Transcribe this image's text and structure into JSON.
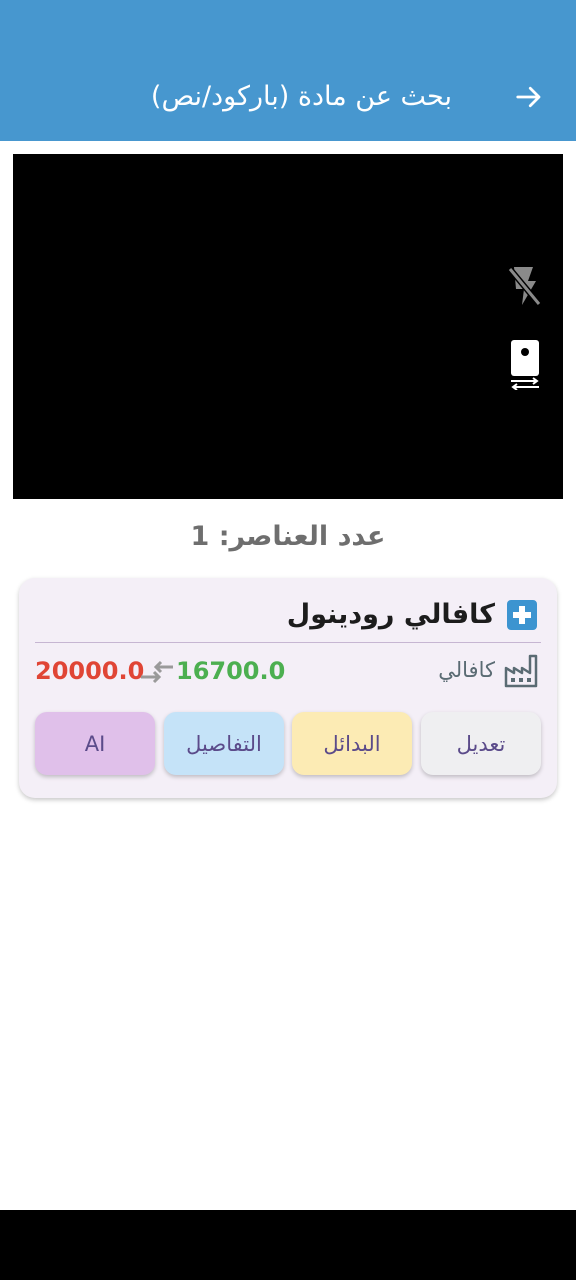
{
  "app_bar": {
    "title": "بحث عن مادة (باركود/نص)",
    "back_icon": "arrow-forward-icon",
    "color": "#4797cf"
  },
  "camera": {
    "flash_icon": "flash-off-icon",
    "switch_camera_icon": "camera-switch-icon"
  },
  "results": {
    "count_label": "عدد العناصر: 1"
  },
  "item": {
    "name": "كافالي رودينول",
    "category_icon": "medical-plus-icon",
    "manufacturer_icon": "factory-icon",
    "manufacturer": "كافالي",
    "new_price": "16700.0",
    "old_price": "20000.0",
    "price_change_icon": "swap-arrows-icon",
    "actions": {
      "edit": "تعديل",
      "alternatives": "البدائل",
      "details": "التفاصيل",
      "ai": "AI"
    }
  }
}
